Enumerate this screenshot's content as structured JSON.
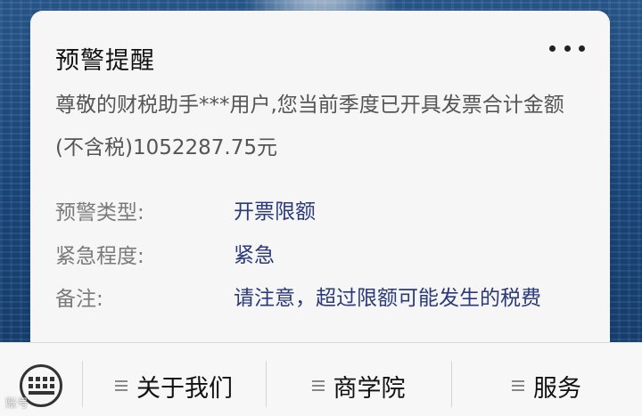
{
  "card": {
    "title": "预警提醒",
    "message": "尊敬的财税助手***用户,您当前季度已开具发票合计金额(不含税)1052287.75元",
    "fields": [
      {
        "label": "预警类型:",
        "value": "开票限额"
      },
      {
        "label": "紧急程度:",
        "value": "紧急"
      },
      {
        "label": "备注:",
        "value": "请注意，超过限额可能发生的税费"
      }
    ]
  },
  "menu": {
    "items": [
      {
        "label": "关于我们"
      },
      {
        "label": "商学院"
      },
      {
        "label": "服务"
      }
    ]
  },
  "watermark": "账号"
}
